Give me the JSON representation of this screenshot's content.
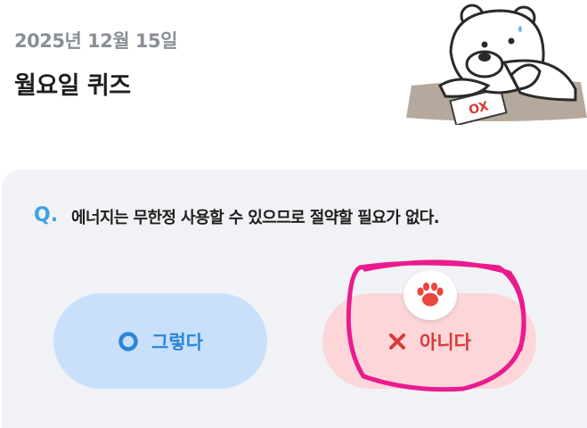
{
  "header": {
    "date": "2025년 12월 15일",
    "title": "월요일 퀴즈"
  },
  "illustration": {
    "icon": "polar-bear-thinking-icon",
    "paper_text": "OX"
  },
  "quiz": {
    "q_label": "Q.",
    "question": "에너지는 무한정 사용할 수 있으므로 절약할 필요가 없다.",
    "answers": [
      {
        "label": "그렇다",
        "icon": "circle-o-icon",
        "color": "#2d86d6",
        "bg": "#c9e0fb"
      },
      {
        "label": "아니다",
        "icon": "x-icon",
        "color": "#d83a3a",
        "bg": "#fcd6d9"
      }
    ],
    "selected_badge_icon": "paw-icon"
  },
  "colors": {
    "accent_q": "#3fa0e6",
    "annotation": "#ea1a8f"
  }
}
